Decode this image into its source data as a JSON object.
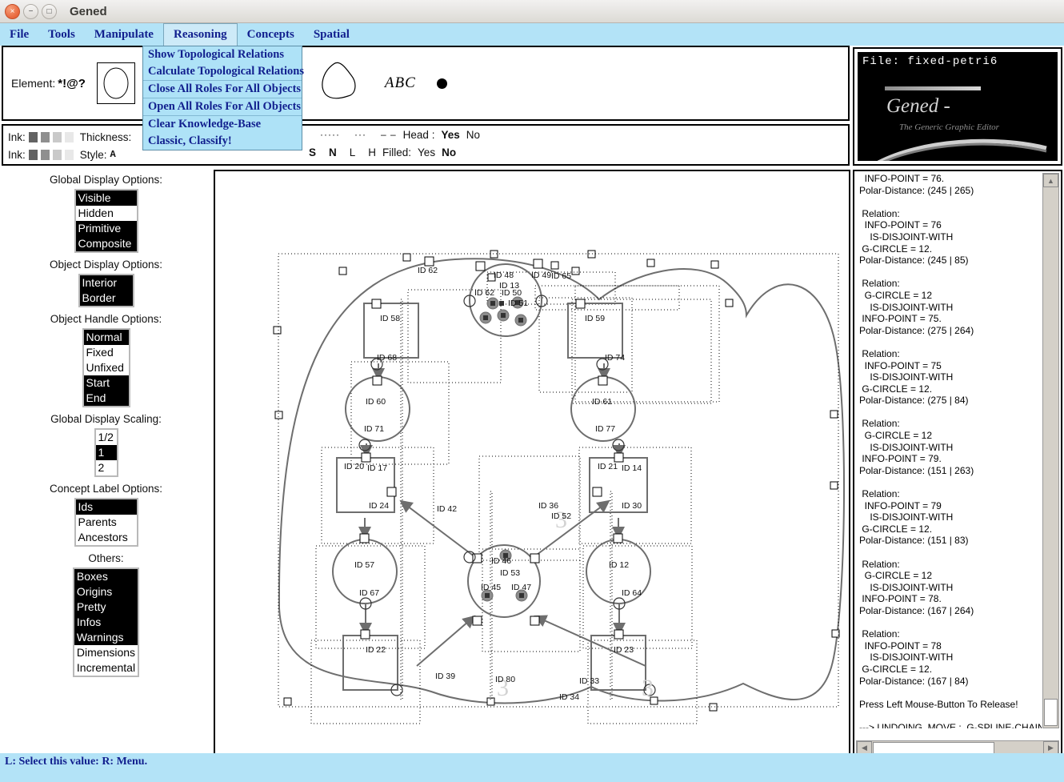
{
  "window": {
    "title": "Gened",
    "buttons": {
      "close": "×",
      "minimize": "−",
      "maximize": "□"
    }
  },
  "menubar": {
    "items": [
      {
        "label": "File",
        "active": false
      },
      {
        "label": "Tools",
        "active": false
      },
      {
        "label": "Manipulate",
        "active": false
      },
      {
        "label": "Reasoning",
        "active": true
      },
      {
        "label": "Concepts",
        "active": false
      },
      {
        "label": "Spatial",
        "active": false
      }
    ]
  },
  "dropdown": {
    "owner": "Reasoning",
    "items": [
      {
        "label": "Show Topological Relations",
        "separator_above": false
      },
      {
        "label": "Calculate Topological Relations",
        "separator_above": false
      },
      {
        "label": "Close All Roles For All Objects",
        "separator_above": true
      },
      {
        "label": "Open All Roles For All Objects",
        "separator_above": true
      },
      {
        "label": "Clear Knowledge-Base",
        "separator_above": true
      },
      {
        "label": "Classic, Classify!",
        "separator_above": false
      }
    ]
  },
  "element_toolbar": {
    "label": "Element:",
    "glyphs": "*!@?",
    "shapes": [
      "ellipse-shape",
      "polyline-shape",
      "polygon-shape",
      "spline-blob-shape"
    ],
    "text_tool": "ABC",
    "dot_tool": "filled-dot"
  },
  "ink_toolbar": {
    "ink_label_1": "Ink:",
    "ink_label_2": "Ink:",
    "swatches": [
      "#636363",
      "#8f8f8f",
      "#c9c9c9",
      "#e8e8e8"
    ],
    "thickness_label": "Thickness:",
    "style_label": "Style:",
    "style_value": "A",
    "dash_samples": [
      "·····",
      "···",
      "– –"
    ],
    "line_caps": [
      "S",
      "N",
      "L",
      "H"
    ],
    "head_label": "Head :",
    "head_yes": "Yes",
    "head_no": "No",
    "head_selected": "Yes",
    "filled_label": "Filled:",
    "filled_yes": "Yes",
    "filled_no": "No",
    "filled_selected": "No"
  },
  "logo_panel": {
    "file_label": "File:",
    "file_name": "fixed-petri6",
    "brand": "Gened -",
    "tagline": "The Generic Graphic Editor"
  },
  "sidebar": {
    "sections": [
      {
        "title": "Global Display Options:",
        "name": "global-display-options",
        "width_class": "lb-w-100",
        "items": [
          {
            "label": "Visible",
            "selected": true
          },
          {
            "label": "Hidden",
            "selected": false
          },
          {
            "label": "Primitive",
            "selected": true
          },
          {
            "label": "Composite",
            "selected": true
          }
        ]
      },
      {
        "title": "Object Display Options:",
        "name": "object-display-options",
        "width_class": "lb-w-90",
        "items": [
          {
            "label": "Interior",
            "selected": true
          },
          {
            "label": "Border",
            "selected": true
          }
        ]
      },
      {
        "title": "Object Handle Options:",
        "name": "object-handle-options",
        "width_class": "lb-w-80",
        "items": [
          {
            "label": "Normal",
            "selected": true
          },
          {
            "label": "Fixed",
            "selected": false
          },
          {
            "label": "Unfixed",
            "selected": false
          },
          {
            "label": "Start",
            "selected": true
          },
          {
            "label": "End",
            "selected": true
          }
        ]
      },
      {
        "title": "Global Display Scaling:",
        "name": "global-display-scaling",
        "width_class": "lb-w-30",
        "items": [
          {
            "label": "1/2",
            "selected": false
          },
          {
            "label": "1",
            "selected": true
          },
          {
            "label": "2",
            "selected": false
          }
        ]
      },
      {
        "title": "Concept Label Options:",
        "name": "concept-label-options",
        "width_class": "lb-w-100",
        "items": [
          {
            "label": "Ids",
            "selected": true
          },
          {
            "label": "Parents",
            "selected": false
          },
          {
            "label": "Ancestors",
            "selected": false
          }
        ]
      },
      {
        "title": "Others:",
        "name": "others-options",
        "width_class": "lb-w-100",
        "items": [
          {
            "label": "Boxes",
            "selected": true
          },
          {
            "label": "Origins",
            "selected": true
          },
          {
            "label": "Pretty",
            "selected": true
          },
          {
            "label": "Infos",
            "selected": true
          },
          {
            "label": "Warnings",
            "selected": true
          },
          {
            "label": "Dimensions",
            "selected": false
          },
          {
            "label": "Incremental",
            "selected": false
          }
        ]
      }
    ]
  },
  "canvas": {
    "node_labels": [
      "ID 62",
      "ID 65",
      "ID 48",
      "ID 13",
      "ID 62",
      "ID 50",
      "ID 51",
      "ID 49",
      "ID 58",
      "ID 59",
      "ID 68",
      "ID 74",
      "ID 60",
      "ID 61",
      "ID 71",
      "ID 77",
      "ID 20",
      "ID 17",
      "ID 21",
      "ID 14",
      "ID 24",
      "ID 30",
      "ID 42",
      "ID 36",
      "ID 52",
      "ID 57",
      "ID 12",
      "ID 67",
      "ID 64",
      "ID 46",
      "ID 53",
      "ID 45",
      "ID 47",
      "ID 80",
      "ID 22",
      "ID 23",
      "ID 39",
      "ID 33",
      "ID 34"
    ]
  },
  "output": {
    "text": "  INFO-POINT = 76.\nPolar-Distance: (245 | 265)\n\n Relation:\n  INFO-POINT = 76\n    IS-DISJOINT-WITH\n G-CIRCLE = 12.\nPolar-Distance: (245 | 85)\n\n Relation:\n  G-CIRCLE = 12\n    IS-DISJOINT-WITH\n INFO-POINT = 75.\nPolar-Distance: (275 | 264)\n\n Relation:\n  INFO-POINT = 75\n    IS-DISJOINT-WITH\n G-CIRCLE = 12.\nPolar-Distance: (275 | 84)\n\n Relation:\n  G-CIRCLE = 12\n    IS-DISJOINT-WITH\n INFO-POINT = 79.\nPolar-Distance: (151 | 263)\n\n Relation:\n  INFO-POINT = 79\n    IS-DISJOINT-WITH\n G-CIRCLE = 12.\nPolar-Distance: (151 | 83)\n\n Relation:\n  G-CIRCLE = 12\n    IS-DISJOINT-WITH\n INFO-POINT = 78.\nPolar-Distance: (167 | 264)\n\n Relation:\n  INFO-POINT = 78\n    IS-DISJOINT-WITH\n G-CIRCLE = 12.\nPolar-Distance: (167 | 84)\n\nPress Left Mouse-Button To Release!\n\n---> UNDOING  MOVE :  G-SPLINE-CHAIN =",
    "scroll_up_arrow": "▲",
    "scroll_down_arrow": "▼",
    "scroll_left_arrow": "◀",
    "scroll_right_arrow": "▶"
  },
  "statusbar": {
    "text": "L: Select this value: R: Menu."
  },
  "colors": {
    "menu_bg": "#b3e3f7",
    "menu_text": "#111f8e",
    "selection_bg": "#000000",
    "canvas_stroke": "#6e6e6e"
  }
}
